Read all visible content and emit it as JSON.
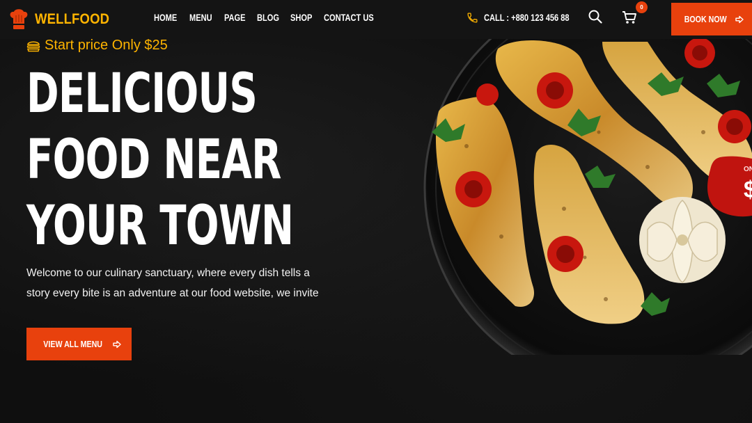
{
  "brand": {
    "name": "WELLFOOD",
    "accent": "#e8410d",
    "gold": "#ffb400"
  },
  "nav": {
    "items": [
      {
        "label": "HOME"
      },
      {
        "label": "MENU"
      },
      {
        "label": "PAGE"
      },
      {
        "label": "BLOG"
      },
      {
        "label": "SHOP"
      },
      {
        "label": "CONTACT US"
      }
    ]
  },
  "header": {
    "call_label": "CALL : +880 123 456 88",
    "cart_count": "0",
    "book_label": "BOOK NOW",
    "icons": [
      "phone-icon",
      "search-icon",
      "cart-icon",
      "arrow-right-icon"
    ]
  },
  "hero": {
    "tagline": "Start price Only $25",
    "headline": [
      "DELICIOUS",
      "FOOD NEAR",
      "YOUR TOWN"
    ],
    "description": "Welcome to our culinary sanctuary, where every dish tells a story every bite is an adventure at our food website, we invite",
    "cta_label": "VIEW ALL MENU"
  },
  "promo": {
    "fragment_top": "ON",
    "fragment_price": "$"
  }
}
